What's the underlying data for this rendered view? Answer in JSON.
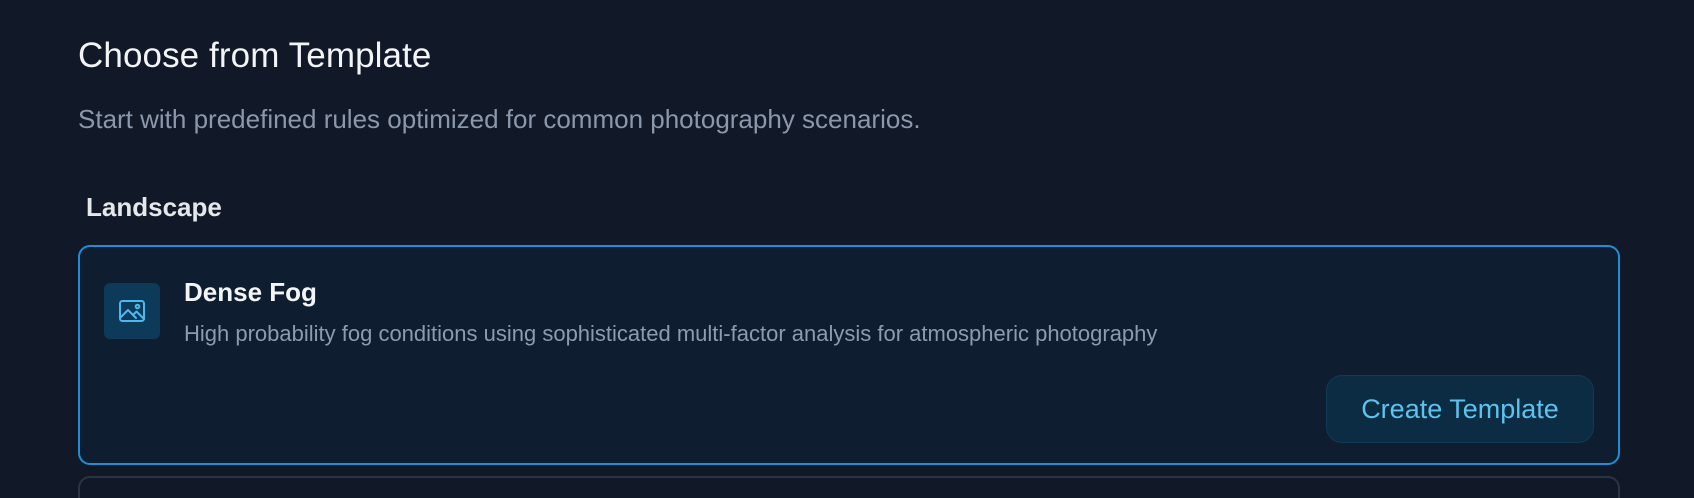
{
  "header": {
    "title": "Choose from Template",
    "subtitle": "Start with predefined rules optimized for common photography scenarios."
  },
  "sections": [
    {
      "heading": "Landscape",
      "templates": [
        {
          "icon": "image-icon",
          "title": "Dense Fog",
          "description": "High probability fog conditions using sophisticated multi-factor analysis for atmospheric photography",
          "button_label": "Create Template"
        }
      ]
    }
  ],
  "colors": {
    "background": "#111827",
    "card_border_selected": "#1c8fd6",
    "card_background": "#0f1d30",
    "accent_text": "#5cc3ee",
    "button_background": "#0c2c44",
    "icon_tile": "#0c3a58",
    "muted_text": "#8e9ab0"
  }
}
